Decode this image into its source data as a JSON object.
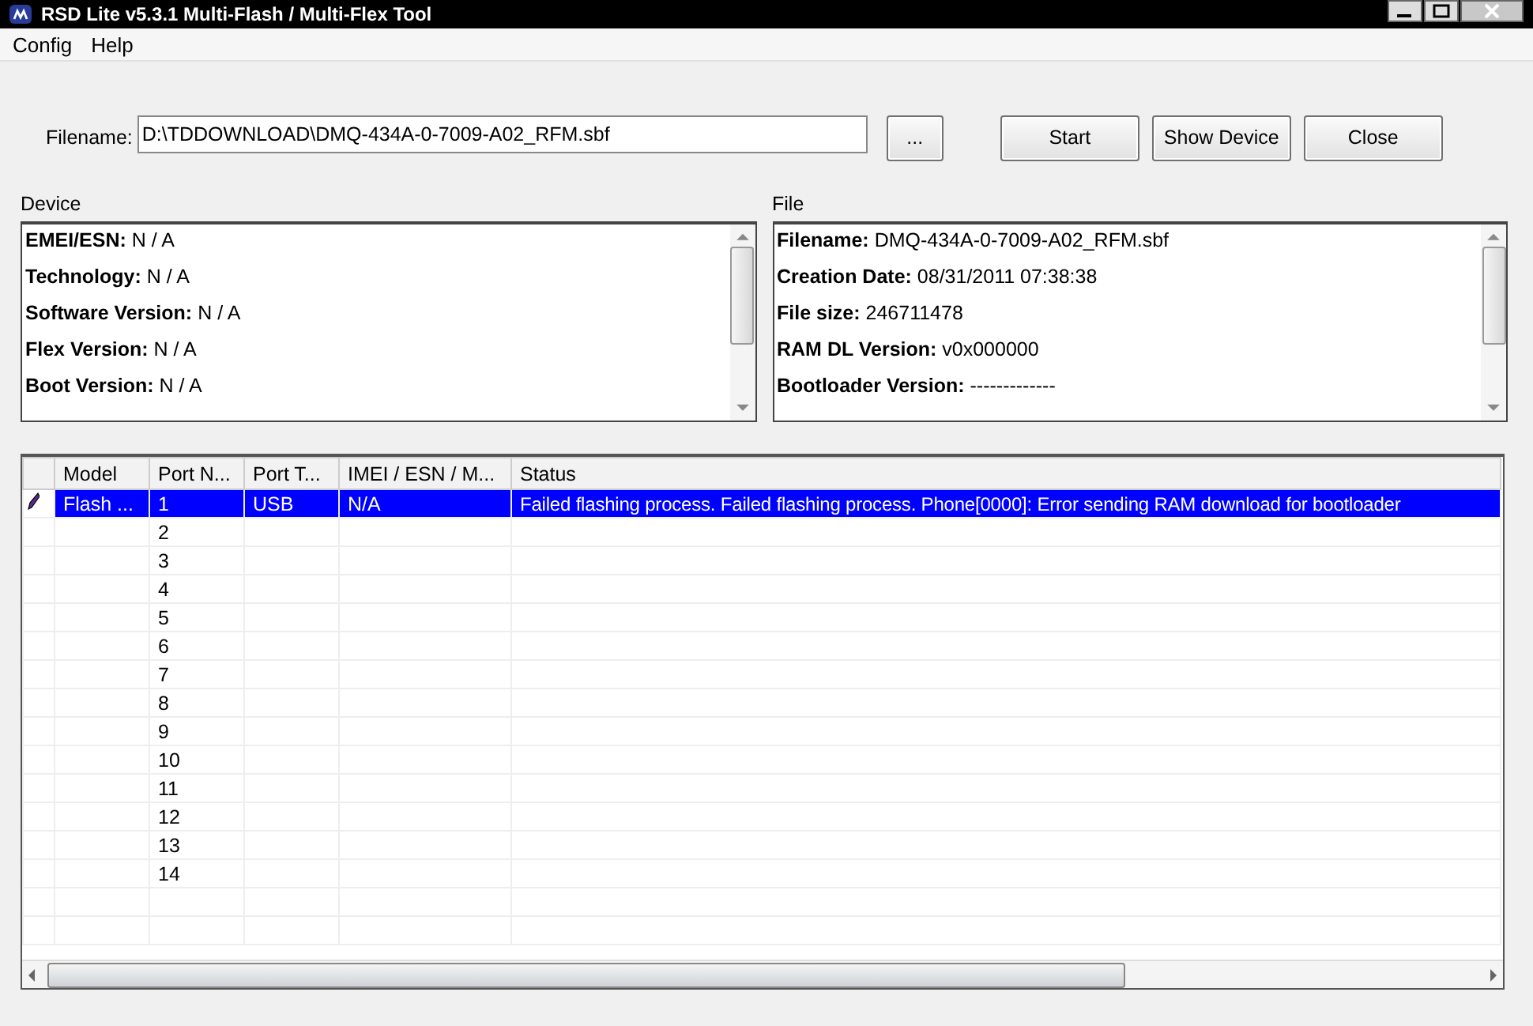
{
  "window": {
    "title": "RSD Lite v5.3.1 Multi-Flash / Multi-Flex Tool"
  },
  "menu": [
    "Config",
    "Help"
  ],
  "filename_field": {
    "label": "Filename:",
    "value": "D:\\TDDOWNLOAD\\DMQ-434A-0-7009-A02_RFM.sbf"
  },
  "browse_button": "...",
  "buttons": [
    "Start",
    "Show Device",
    "Close"
  ],
  "device": {
    "title": "Device",
    "fields": [
      {
        "label": "EMEI/ESN:",
        "value": "N / A"
      },
      {
        "label": "Technology:",
        "value": "N / A"
      },
      {
        "label": "Software Version:",
        "value": "N / A"
      },
      {
        "label": "Flex Version:",
        "value": "N / A"
      },
      {
        "label": "Boot Version:",
        "value": "N / A"
      }
    ]
  },
  "file": {
    "title": "File",
    "fields": [
      {
        "label": "Filename:",
        "value": "DMQ-434A-0-7009-A02_RFM.sbf"
      },
      {
        "label": "Creation Date:",
        "value": "08/31/2011 07:38:38"
      },
      {
        "label": "File size:",
        "value": "246711478"
      },
      {
        "label": "RAM DL Version:",
        "value": "v0x000000"
      },
      {
        "label": "Bootloader Version:",
        "value": "-------------"
      }
    ]
  },
  "table": {
    "columns": [
      "Model",
      "Port N...",
      "Port T...",
      "IMEI / ESN / M...",
      "Status"
    ],
    "rows": [
      {
        "selected": true,
        "cells": [
          "Flash ...",
          "1",
          "USB",
          "N/A",
          "Failed flashing process. Failed flashing process. Phone[0000]: Error sending RAM download for bootloader"
        ]
      },
      {
        "selected": false,
        "cells": [
          "",
          "2",
          "",
          "",
          ""
        ]
      },
      {
        "selected": false,
        "cells": [
          "",
          "3",
          "",
          "",
          ""
        ]
      },
      {
        "selected": false,
        "cells": [
          "",
          "4",
          "",
          "",
          ""
        ]
      },
      {
        "selected": false,
        "cells": [
          "",
          "5",
          "",
          "",
          ""
        ]
      },
      {
        "selected": false,
        "cells": [
          "",
          "6",
          "",
          "",
          ""
        ]
      },
      {
        "selected": false,
        "cells": [
          "",
          "7",
          "",
          "",
          ""
        ]
      },
      {
        "selected": false,
        "cells": [
          "",
          "8",
          "",
          "",
          ""
        ]
      },
      {
        "selected": false,
        "cells": [
          "",
          "9",
          "",
          "",
          ""
        ]
      },
      {
        "selected": false,
        "cells": [
          "",
          "10",
          "",
          "",
          ""
        ]
      },
      {
        "selected": false,
        "cells": [
          "",
          "11",
          "",
          "",
          ""
        ]
      },
      {
        "selected": false,
        "cells": [
          "",
          "12",
          "",
          "",
          ""
        ]
      },
      {
        "selected": false,
        "cells": [
          "",
          "13",
          "",
          "",
          ""
        ]
      },
      {
        "selected": false,
        "cells": [
          "",
          "14",
          "",
          "",
          ""
        ]
      }
    ]
  }
}
